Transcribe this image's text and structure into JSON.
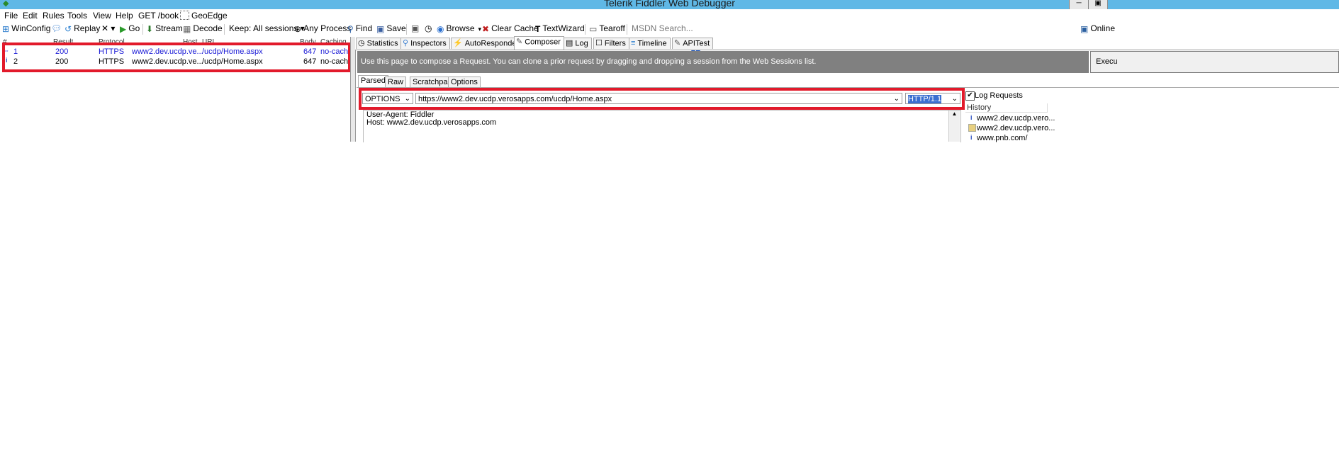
{
  "window": {
    "title": "Telerik Fiddler Web Debugger"
  },
  "menu": [
    "File",
    "Edit",
    "Rules",
    "Tools",
    "View",
    "Help",
    "GET /book",
    "GeoEdge"
  ],
  "toolbar": {
    "winconfig": "WinConfig",
    "replay": "Replay",
    "remove": "✕ ▾",
    "go": "Go",
    "stream": "Stream",
    "decode": "Decode",
    "keep": "Keep: All sessions ▾",
    "any_process": "Any Process",
    "find": "Find",
    "save": "Save",
    "browse": "Browse",
    "clear_cache": "Clear Cache",
    "textwizard": "TextWizard",
    "tearoff": "Tearoff",
    "msdn_search": "MSDN Search...",
    "online": "Online"
  },
  "sessions": {
    "columns": [
      "#",
      "Result",
      "Protocol",
      "Host",
      "URL",
      "Body",
      "Caching"
    ],
    "rows": [
      {
        "num": "1",
        "result": "200",
        "protocol": "HTTPS",
        "host": "www2.dev.ucdp.ve...",
        "url": "/ucdp/Home.aspx",
        "body": "647",
        "caching": "no-cache",
        "highlight": true
      },
      {
        "num": "2",
        "result": "200",
        "protocol": "HTTPS",
        "host": "www2.dev.ucdp.ve...",
        "url": "/ucdp/Home.aspx",
        "body": "647",
        "caching": "no-cache",
        "highlight": false
      }
    ]
  },
  "tabs": [
    "Statistics",
    "Inspectors",
    "AutoResponder",
    "Composer",
    "Log",
    "Filters",
    "Timeline",
    "APITest"
  ],
  "active_tab": "Composer",
  "composer": {
    "info": "Use this page to compose a Request. You can clone a prior request by dragging and dropping a session from the Web Sessions list.",
    "execute": "Execu",
    "subtabs": [
      "Parsed",
      "Raw",
      "Scratchpad",
      "Options"
    ],
    "active_subtab": "Parsed",
    "method": "OPTIONS",
    "url": "https://www2.dev.ucdp.verosapps.com/ucdp/Home.aspx",
    "http_version": "HTTP/1.1",
    "headers": [
      "User-Agent: Fiddler",
      "Host: www2.dev.ucdp.verosapps.com"
    ],
    "log_requests_label": "Log Requests",
    "log_requests_checked": true,
    "history_label": "History",
    "history": [
      "www2.dev.ucdp.vero...",
      "www2.dev.ucdp.vero...",
      "www.pnb.com/"
    ]
  },
  "colors": {
    "titlebar": "#5fb8e6",
    "highlight_box": "#e21a2b",
    "session_blue": "#1a1ad6",
    "info_bar": "#808080"
  }
}
